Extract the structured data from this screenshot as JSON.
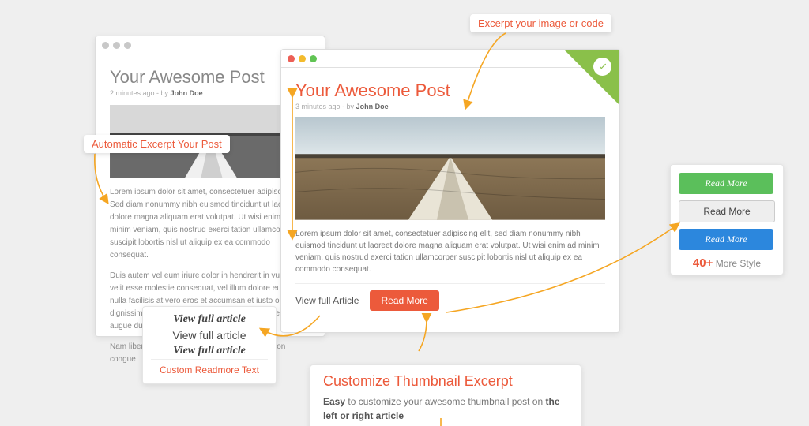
{
  "callouts": {
    "excerpt_image": "Excerpt your image or code",
    "auto_excerpt": "Automatic Excerpt Your Post",
    "custom_readmore": "Custom Readmore Text",
    "thumb_title": "Customize Thumbnail Excerpt",
    "thumb_desc_prefix": "Easy",
    "thumb_desc_mid": " to customize your awesome thumbnail post on ",
    "thumb_desc_bold": "the left or right article"
  },
  "window_grey": {
    "title": "Your Awesome Post",
    "meta_time": "2 minutes ago",
    "meta_by": "by",
    "meta_author": "John Doe",
    "lorem1": "Lorem ipsum dolor sit amet, consectetuer adipiscing elit. Sed diam nonummy nibh euismod tincidunt ut laoreet dolore magna aliquam erat volutpat. Ut wisi enim ad minim veniam, quis nostrud exerci tation ullamcorper suscipit lobortis nisl ut aliquip ex ea commodo consequat.",
    "lorem2": "Duis autem vel eum iriure dolor in hendrerit in vulputate velit esse molestie consequat, vel illum dolore eu feugiat nulla facilisis at vero eros et accumsan et iusto odio dignissim qui blandit praesent luptatum zzril delenit augue duis dolore te feugait nulla facilisi.",
    "lorem3": "Nam liber tempor cum soluta nobis eleifend option congue"
  },
  "window_color": {
    "title": "Your Awesome Post",
    "meta_time": "3 minutes ago",
    "meta_by": "by",
    "meta_author": "John Doe",
    "lorem": "Lorem ipsum dolor sit amet, consectetuer adipiscing elit, sed diam nonummy nibh euismod tincidunt ut laoreet dolore magna aliquam erat volutpat. Ut wisi enim ad minim veniam, quis nostrud exerci tation ullamcorper suscipit lobortis nisl ut aliquip ex ea commodo consequat.",
    "view_full": "View full Article",
    "read_more": "Read More"
  },
  "readmore_variants": {
    "v1": "View full article",
    "v2": "View full article",
    "v3": "View full article"
  },
  "style_panel": {
    "btn1": "Read More",
    "btn2": "Read More",
    "btn3": "Read More",
    "count": "40+",
    "more": " More Style"
  }
}
